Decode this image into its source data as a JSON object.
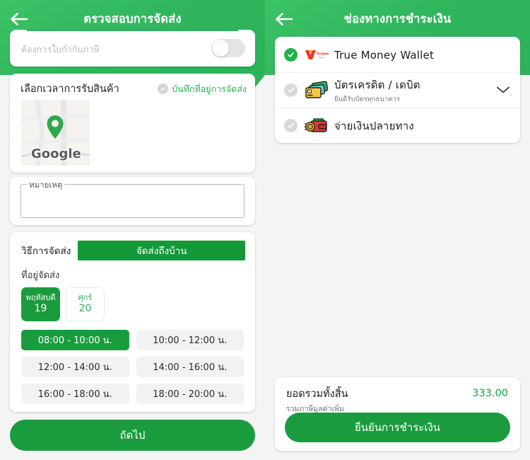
{
  "left": {
    "header": {
      "title": "ตรวจสอบการจัดส่ง",
      "back_icon": "arrow-left-icon"
    },
    "vat": {
      "label": "ต้องการใบกำกับภาษี",
      "toggle_on": false
    },
    "map": {
      "title": "เลือกเวลาการรับสินค้า",
      "save_address_label": "บันทึกที่อยู่การจัดส่ง",
      "save_address_checked": false,
      "watermark": "Google",
      "pin_icon": "map-pin-icon"
    },
    "note": {
      "legend": "หมายเหตุ",
      "value": ""
    },
    "delivery": {
      "method_label": "วิธีการจัดส่ง",
      "method_value": "จัดส่งถึงบ้าน",
      "address_label": "ที่อยู่จัดส่ง",
      "dates": [
        {
          "dow": "พฤหัสบดี",
          "num": "19",
          "selected": true
        },
        {
          "dow": "ศุกร์",
          "num": "20",
          "selected": false
        }
      ],
      "slots": [
        {
          "label": "08:00 - 10:00 น.",
          "selected": true
        },
        {
          "label": "10:00 - 12:00 น.",
          "selected": false
        },
        {
          "label": "12:00 - 14:00 น.",
          "selected": false
        },
        {
          "label": "14:00 - 16:00 น.",
          "selected": false
        },
        {
          "label": "16:00 - 18:00 น.",
          "selected": false
        },
        {
          "label": "18:00 - 20:00 น.",
          "selected": false
        }
      ]
    },
    "next_button": "ถัดไป"
  },
  "right": {
    "header": {
      "title": "ช่องทางการชำระเงิน",
      "back_icon": "arrow-left-icon"
    },
    "methods": [
      {
        "name": "True Money Wallet",
        "sub": "",
        "selected": true,
        "icon": "truemoney-logo-icon",
        "chevron": false
      },
      {
        "name": "บัตรเครดิต / เดบิต",
        "sub": "ยินดีรับบัตรทุกธนาคาร",
        "selected": false,
        "icon": "credit-cards-icon",
        "chevron": true
      },
      {
        "name": "จ่ายเงินปลายทาง",
        "sub": "",
        "selected": false,
        "icon": "wallet-coin-icon",
        "chevron": false
      }
    ],
    "total": {
      "label": "ยอดรวมทั้งสิ้น",
      "sub": "รวมภาษีมูลค่าเพิ่ม",
      "amount": "333.00"
    },
    "confirm_button": "ยืนยันการชำระเงิน"
  },
  "colors": {
    "header_green": "#2fb65d",
    "action_green": "#1a9c3e",
    "accent_green": "#2fad58",
    "amount_green": "#17a33f"
  }
}
